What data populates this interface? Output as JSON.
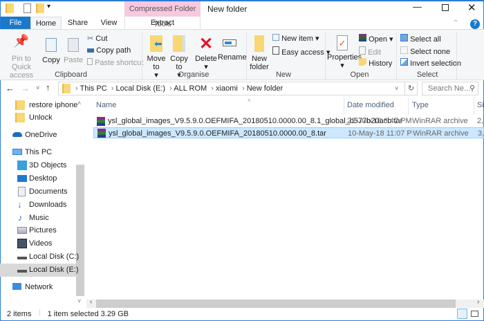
{
  "titlebar": {
    "title": "New folder",
    "context_tab": "Compressed Folder Tools"
  },
  "tabs": {
    "file": "File",
    "home": "Home",
    "share": "Share",
    "view": "View",
    "extract": "Extract"
  },
  "ribbon": {
    "clipboard": {
      "label": "Clipboard",
      "pin": "Pin to Quick access",
      "copy": "Copy",
      "paste": "Paste",
      "cut": "Cut",
      "copy_path": "Copy path",
      "paste_shortcut": "Paste shortcut"
    },
    "organise": {
      "label": "Organise",
      "move_to": "Move to",
      "copy_to": "Copy to",
      "delete": "Delete",
      "rename": "Rename"
    },
    "new": {
      "label": "New",
      "new_folder": "New folder",
      "new_item": "New item",
      "easy_access": "Easy access"
    },
    "open": {
      "label": "Open",
      "properties": "Properties",
      "open": "Open",
      "edit": "Edit",
      "history": "History"
    },
    "select": {
      "label": "Select",
      "select_all": "Select all",
      "select_none": "Select none",
      "invert": "Invert selection"
    }
  },
  "address": {
    "crumbs": [
      "This PC",
      "Local Disk (E:)",
      "ALL ROM",
      "xiaomi",
      "New folder"
    ],
    "search_placeholder": "Search Ne..."
  },
  "nav": [
    "restore iphone",
    "Unlock",
    "OneDrive",
    "This PC",
    "3D Objects",
    "Desktop",
    "Documents",
    "Downloads",
    "Music",
    "Pictures",
    "Videos",
    "Local Disk (C:)",
    "Local Disk (E:)",
    "Network"
  ],
  "columns": {
    "name": "Name",
    "date": "Date modified",
    "type": "Type",
    "size": "Si"
  },
  "files": [
    {
      "name": "ysl_global_images_V9.5.9.0.OEFMIFA_20180510.0000.00_8.1_global_b577b20acb.tar",
      "date": "22-Jun-18 6:47 PM",
      "type": "WinRAR archive",
      "size": "2,"
    },
    {
      "name": "ysl_global_images_V9.5.9.0.OEFMIFA_20180510.0000.00_8.tar",
      "date": "10-May-18 11:07 P",
      "type": "WinRAR archive",
      "size": "3,"
    }
  ],
  "status": {
    "count": "2 items",
    "selected": "1 item selected",
    "size": "3.29 GB"
  }
}
